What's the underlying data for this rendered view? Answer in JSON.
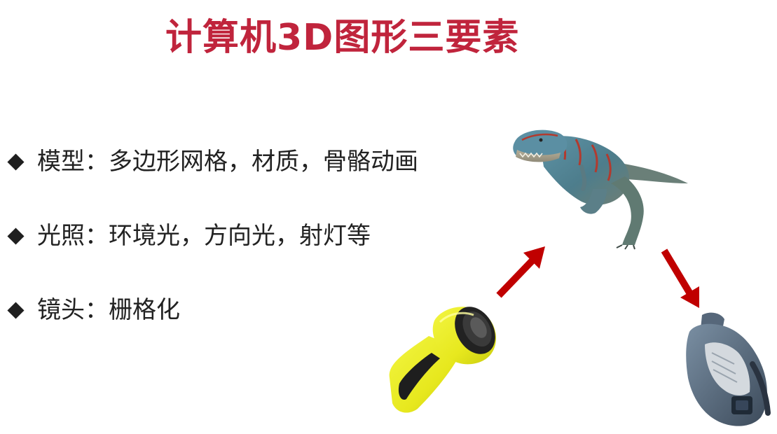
{
  "slide": {
    "title": "计算机3D图形三要素",
    "title_color": "#c0243c",
    "bullet_icon": "diamond-bullet-icon",
    "bullets": [
      {
        "text": "模型：多边形网格，材质，骨骼动画"
      },
      {
        "text": "光照：环境光，方向光，射灯等"
      },
      {
        "text": "镜头：栅格化"
      }
    ],
    "illustration": {
      "model_image": "t-rex-dinosaur-model",
      "light_image": "yellow-flashlight",
      "camera_image": "video-camera",
      "arrow_color": "#c00000"
    }
  }
}
